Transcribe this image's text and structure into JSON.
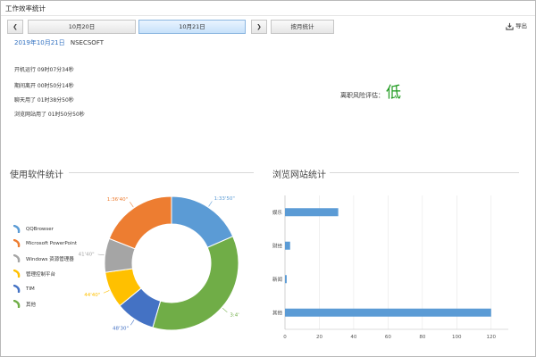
{
  "window": {
    "title": "工作效率统计"
  },
  "toolbar": {
    "prev_label": "❮",
    "next_label": "❯",
    "tabs": [
      {
        "label": "10月20日",
        "active": false
      },
      {
        "label": "10月21日",
        "active": true
      }
    ],
    "monthly_label": "按月统计",
    "export_label": "导出"
  },
  "summary": {
    "date": "2019年10月21日",
    "user": "NSECSOFT",
    "stats": [
      "开机运行 09时07分34秒",
      "期间离开 00时50分14秒",
      "聊天用了 01时38分50秒",
      "浏览网站用了 01时50分50秒"
    ],
    "risk_label": "离职风险评估：",
    "risk_value": "低"
  },
  "software_stats": {
    "title": "使用软件统计"
  },
  "website_stats": {
    "title": "浏览网站统计"
  },
  "colors": {
    "blue": "#5b9bd5",
    "orange": "#ed7d31",
    "gray": "#a5a5a5",
    "yellow": "#ffc000",
    "darkblue": "#4472c4",
    "green": "#70ad47",
    "risk_low": "#1f9a1f"
  },
  "chart_data": [
    {
      "type": "pie",
      "variant": "donut",
      "categories": [
        "QQBrowser",
        "Microsoft PowerPoint",
        "Windows 资源管理器",
        "管理控制平台",
        "TIM",
        "其他"
      ],
      "values": [
        93.8,
        96.7,
        41.7,
        44.7,
        48.5,
        184
      ],
      "data_labels": [
        "1:33'50\"",
        "1:36'40\"",
        "41'40\"",
        "44'40\"",
        "48'30\"",
        "3:4'"
      ],
      "colors": [
        "#5b9bd5",
        "#ed7d31",
        "#a5a5a5",
        "#ffc000",
        "#4472c4",
        "#70ad47"
      ],
      "legend": "left"
    },
    {
      "type": "bar",
      "orientation": "horizontal",
      "categories": [
        "娱乐",
        "财经",
        "新闻",
        "其他"
      ],
      "values": [
        31,
        3,
        1,
        120
      ],
      "xlim": [
        0,
        130
      ],
      "xticks": [
        0,
        20,
        40,
        60,
        80,
        100,
        120
      ],
      "grid": true,
      "color": "#5b9bd5"
    }
  ]
}
